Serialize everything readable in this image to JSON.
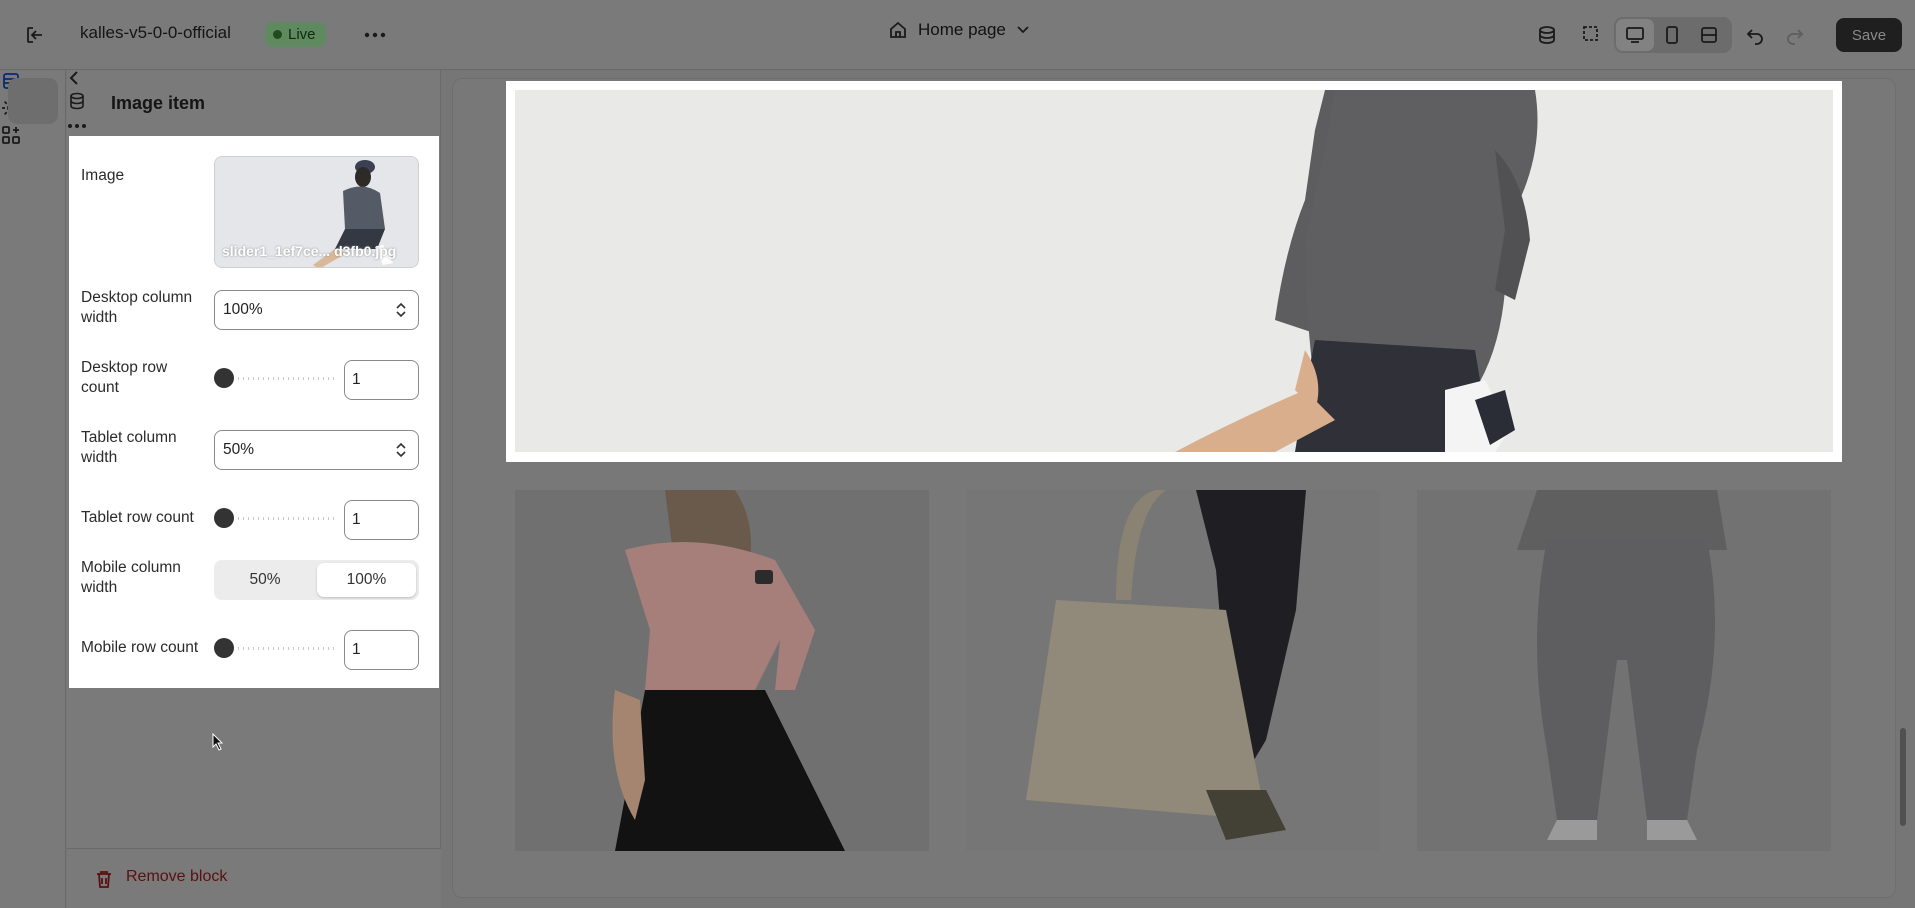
{
  "topbar": {
    "store_name": "kalles-v5-0-0-official",
    "status_badge": "Live",
    "page_selector": "Home page",
    "save_label": "Save"
  },
  "panel": {
    "title": "Image item",
    "remove_block_label": "Remove block"
  },
  "settings": {
    "image_label": "Image",
    "image_filename": "slider1_1ef7ce... d3fb0.jpg",
    "desktop_column_width_label": "Desktop column width",
    "desktop_column_width_value": "100%",
    "desktop_row_count_label": "Desktop row count",
    "desktop_row_count_value": "1",
    "tablet_column_width_label": "Tablet column width",
    "tablet_column_width_value": "50%",
    "tablet_row_count_label": "Tablet row count",
    "tablet_row_count_value": "1",
    "mobile_column_width_label": "Mobile column width",
    "mobile_column_width_options": [
      "50%",
      "100%"
    ],
    "mobile_column_width_selected": "100%",
    "mobile_row_count_label": "Mobile row count",
    "mobile_row_count_value": "1"
  },
  "colors": {
    "overlay": "#767676",
    "card": "#ffffff",
    "live_badge": "#5f8a5f",
    "remove": "#5a1010"
  }
}
